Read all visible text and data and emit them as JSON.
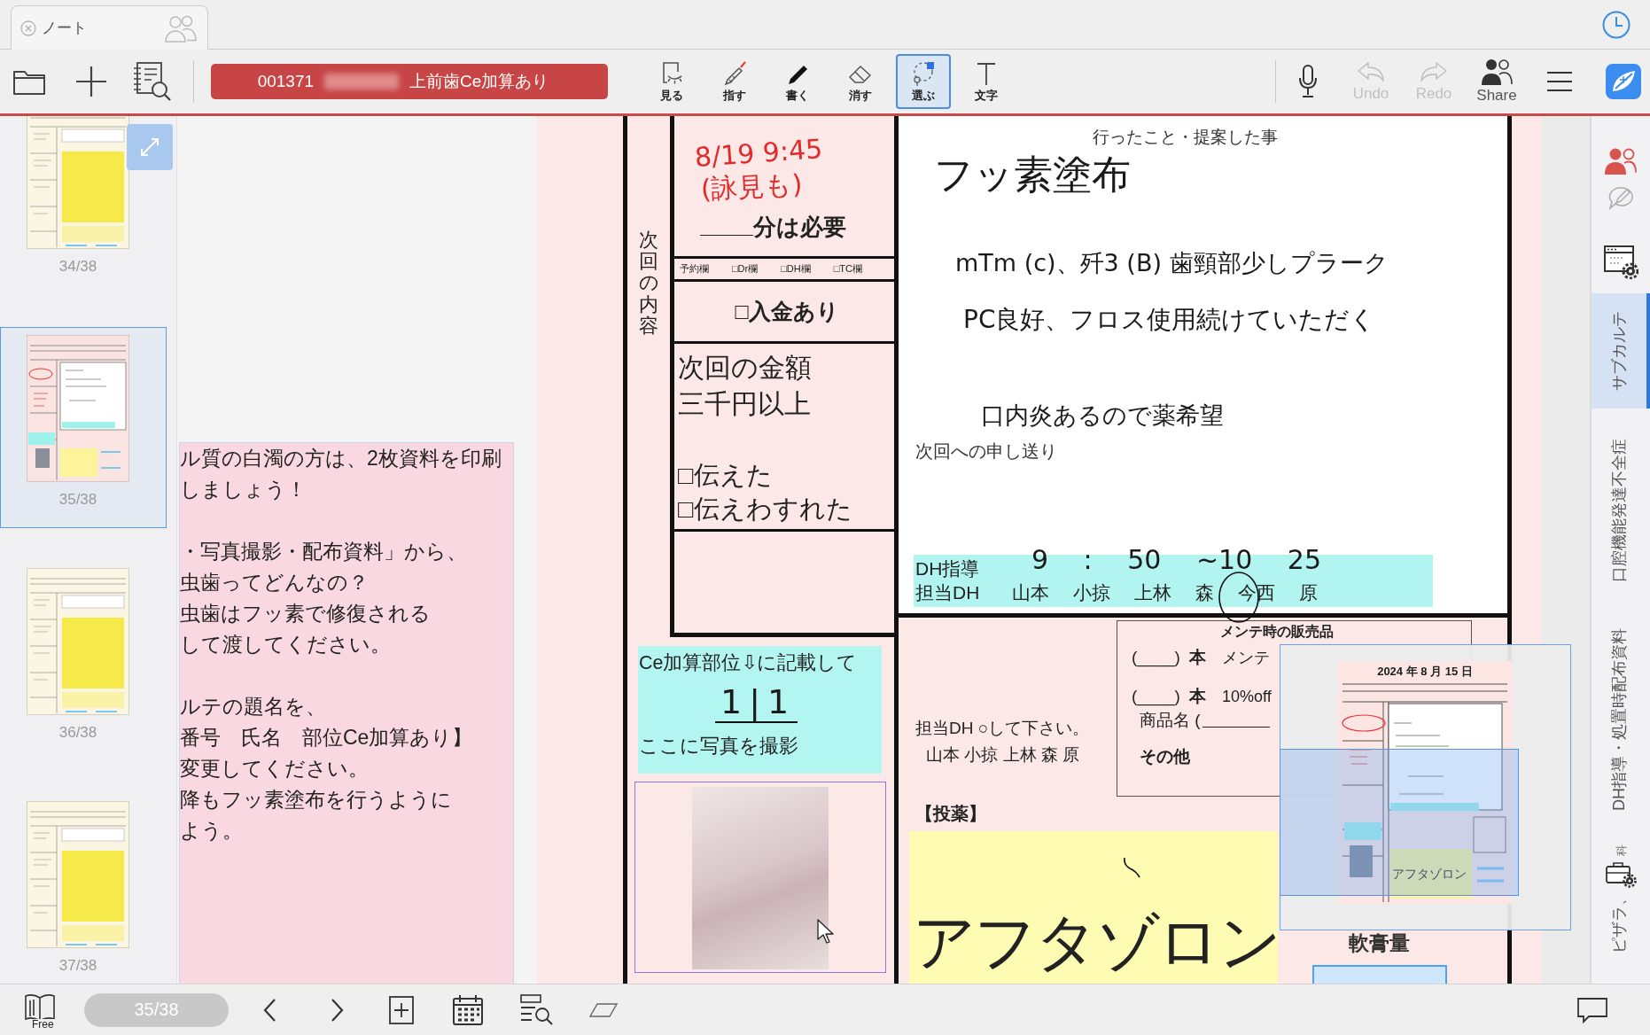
{
  "tab_bar": {
    "tab_title": "ノート"
  },
  "toolbar": {
    "title": {
      "number": "001371",
      "subject": "上前歯Ce加算あり"
    },
    "tools": [
      {
        "kind": "view",
        "label": "見る",
        "selected": false
      },
      {
        "kind": "point",
        "label": "指す",
        "selected": false
      },
      {
        "kind": "write",
        "label": "書く",
        "selected": false
      },
      {
        "kind": "erase",
        "label": "消す",
        "selected": false
      },
      {
        "kind": "select",
        "label": "選ぶ",
        "selected": true
      },
      {
        "kind": "text",
        "label": "文字",
        "selected": false
      }
    ],
    "actions": [
      {
        "kind": "undo",
        "label": "Undo",
        "disabled": true
      },
      {
        "kind": "redo",
        "label": "Redo",
        "disabled": true
      },
      {
        "kind": "share",
        "label": "Share",
        "disabled": false
      }
    ]
  },
  "sidebar": {
    "pages": [
      {
        "label": "34/38",
        "kind": "notes",
        "selected": false
      },
      {
        "label": "35/38",
        "kind": "form",
        "selected": true
      },
      {
        "label": "36/38",
        "kind": "notes",
        "selected": false
      },
      {
        "label": "37/38",
        "kind": "notes",
        "selected": false
      }
    ]
  },
  "note": {
    "paragraphs": [
      {
        "lines": [
          "ル質の白濁の方は、2枚資料を印刷",
          "しましょう！"
        ]
      },
      {
        "lines": [
          "・写真撮影・配布資料」から、",
          "虫歯ってどんなの？",
          "虫歯はフッ素で修復される",
          "して渡してください。"
        ]
      },
      {
        "lines": [
          "ルテの題名を、",
          "番号　氏名　部位Ce加算あり】",
          "変更してください。",
          "降もフッ素塗布を行うように",
          "よう。"
        ]
      }
    ]
  },
  "form": {
    "section_label": "次回の内容",
    "appointment": {
      "ink_date": "8/19 9:45",
      "ink_note": "(詠見も)",
      "duration_suffix": "分は必要"
    },
    "booking_fields": [
      "予約欄",
      "□Dr欄",
      "□DH欄",
      "□TC欄"
    ],
    "payment": "□入金あり",
    "next_fee": [
      "次回の金額",
      "三千円以上"
    ],
    "fee_checks": [
      "□伝えた",
      "□伝えわすれた"
    ],
    "ce_box": {
      "title": "Ce加算部位⇩に記載して",
      "ink_teeth": "1|1",
      "caption": "ここに写真を撮影"
    },
    "record": {
      "heading": "行ったこと・提案した事",
      "ink_lines": [
        "フッ素塗布",
        "mTm (c)、歼3 (B) 歯頸部少しプラーク",
        "PC良好、フロス使用続けていただく",
        "口内炎あるので薬希望"
      ],
      "handover_label": "次回への申し送り"
    },
    "dh_guidance": {
      "label": "DH指導",
      "ink_time": "9 : 50 ~10 25",
      "staff_label": "担当DH",
      "staff": [
        {
          "name": "山本",
          "circled": false
        },
        {
          "name": "小掠",
          "circled": false
        },
        {
          "name": "上林",
          "circled": false
        },
        {
          "name": "森",
          "circled": false
        },
        {
          "name": "今西",
          "circled": true
        },
        {
          "name": "原",
          "circled": false
        }
      ]
    },
    "staff_note": [
      "担当DH ○して下さい。",
      "山本 小掠 上林 森 原"
    ],
    "sales": {
      "title": "メンテ時の販売品",
      "rows": [
        {
          "quantity": "(____)",
          "unit": "本",
          "item": "メンテ"
        },
        {
          "quantity": "(____)",
          "unit": "本",
          "item": "10%off"
        }
      ],
      "product_label": "商品名 (",
      "other_label": "その他"
    },
    "medication": {
      "heading": "【投薬】",
      "drug": "アフタゾロン",
      "ointment_label": "軟膏量"
    }
  },
  "navigator": {
    "date": "2024 年 8 月 15 日",
    "drug": "アフタゾロン"
  },
  "right_sidebar": {
    "tabs": [
      {
        "label": "サブカルテ",
        "selected": true
      },
      {
        "label": "口腔機能発達不全症",
        "selected": false
      },
      {
        "label": "DH指導・処置時配布資料",
        "selected": false
      },
      {
        "label": "ピザラ、",
        "selected": false
      }
    ],
    "covered_text": "科"
  },
  "bottom_bar": {
    "book_label": "Free",
    "page_indicator": "35/38"
  }
}
